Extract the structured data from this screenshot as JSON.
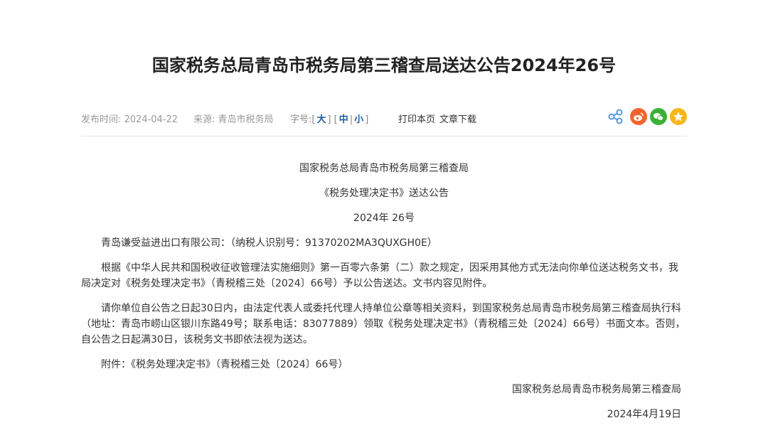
{
  "article": {
    "title": "国家税务总局青岛市税务局第三稽查局送达公告2024年26号"
  },
  "meta": {
    "publish_time": "发布时间: 2024-04-22",
    "source": "来源: 青岛市税务局",
    "font_size_label": "字号:[",
    "font_large": "大",
    "font_medium": "中",
    "font_small": "小",
    "sep1": "]",
    "sep2": "|",
    "sep3": "|",
    "print": "打印本页",
    "download": "文章下载"
  },
  "share": {
    "icons": [
      "share-icon",
      "weibo-icon",
      "wechat-icon",
      "favorite-icon"
    ],
    "colors": [
      "#4a90d9",
      "#f0652d",
      "#3cb034",
      "#f5b71a"
    ]
  },
  "content": {
    "org": "国家税务总局青岛市税务局第三稽查局",
    "doc_name": "《税务处理决定书》送达公告",
    "doc_no": "2024年 26号",
    "addressee": "青岛谦受益进出口有限公司：（纳税人识别号：91370202MA3QUXGH0E）",
    "para1": "根据《中华人民共和国税收征收管理法实施细则》第一百零六条第（二）款之规定，因采用其他方式无法向你单位送达税务文书，我局决定对《税务处理决定书》（青税稽三处〔2024〕66号）予以公告送达。文书内容见附件。",
    "para2": "请你单位自公告之日起30日内，由法定代表人或委托代理人持单位公章等相关资料，到国家税务总局青岛市税务局第三稽查局执行科（地址：青岛市崂山区银川东路49号；联系电话：83077889）领取《税务处理决定书》（青税稽三处〔2024〕66号）书面文本。否则，自公告之日起满30日，该税务文书即依法视为送达。",
    "attachment": "附件：《税务处理决定书》（青税稽三处〔2024〕66号）",
    "signature": "国家税务总局青岛市税务局第三稽查局",
    "date": "2024年4月19日"
  }
}
